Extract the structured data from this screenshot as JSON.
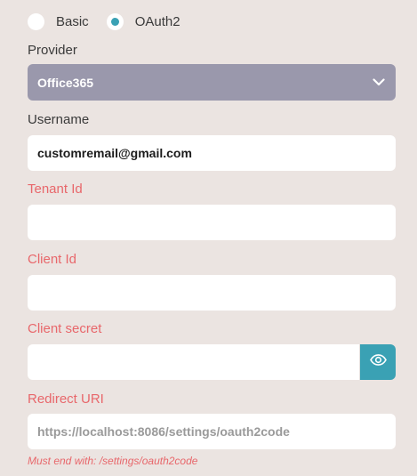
{
  "auth": {
    "options": [
      {
        "label": "Basic",
        "selected": false
      },
      {
        "label": "OAuth2",
        "selected": true
      }
    ]
  },
  "provider": {
    "label": "Provider",
    "value": "Office365"
  },
  "username": {
    "label": "Username",
    "value": "customremail@gmail.com"
  },
  "tenant_id": {
    "label": "Tenant Id",
    "value": ""
  },
  "client_id": {
    "label": "Client Id",
    "value": ""
  },
  "client_secret": {
    "label": "Client secret",
    "value": "",
    "toggle_icon": "eye-icon"
  },
  "redirect_uri": {
    "label": "Redirect URI",
    "placeholder": "https://localhost:8086/settings/oauth2code",
    "hint": "Must end with: /settings/oauth2code"
  },
  "colors": {
    "accent": "#3aa1b4",
    "required_label": "#e8676b",
    "select_bg": "#9a98ac",
    "page_bg": "#ebe4e1"
  }
}
